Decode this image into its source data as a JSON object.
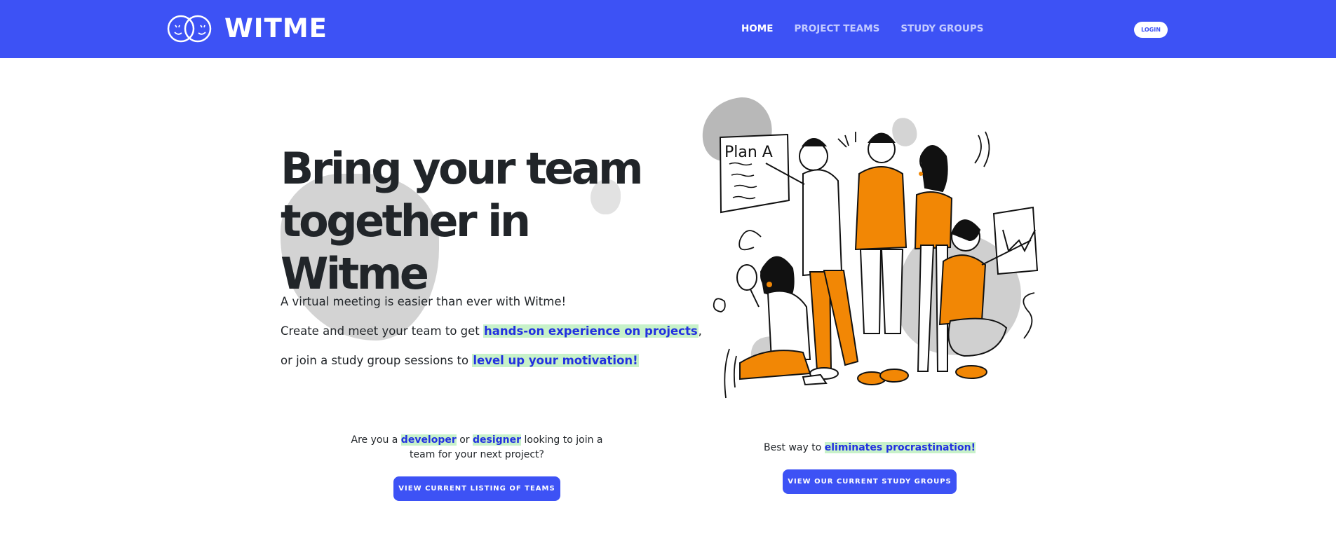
{
  "brand": {
    "name": "WITME",
    "logo_icon": "two-overlapping-smiley-circles-icon"
  },
  "nav": {
    "links": [
      {
        "label": "HOME",
        "active": true
      },
      {
        "label": "PROJECT TEAMS",
        "active": false
      },
      {
        "label": "STUDY GROUPS",
        "active": false
      }
    ],
    "login_label": "LOGIN"
  },
  "hero": {
    "title_line_1": "Bring your team",
    "title_line_2": "together in Witme",
    "line_1": "A virtual meeting is easier than ever with Witme!",
    "line_2_prefix": "Create and meet your team to get ",
    "line_2_highlight": "hands-on experience on projects",
    "line_2_suffix": ",",
    "line_3_prefix": "or join a study group sessions to ",
    "line_3_highlight": "level up your motivation!",
    "illustration_icon": "team-collaboration-illustration",
    "illustration_board_text": "Plan A"
  },
  "cta_teams": {
    "text_prefix": "Are you a ",
    "highlight_1": "developer",
    "text_middle": " or ",
    "highlight_2": "designer",
    "text_suffix": " looking to join a team for your next project?",
    "button_label": "VIEW CURRENT LISTING OF TEAMS"
  },
  "cta_groups": {
    "text_prefix": "Best way to ",
    "highlight": "eliminates procrastination!",
    "button_label": "VIEW OUR CURRENT STUDY GROUPS"
  },
  "colors": {
    "brand_blue": "#3d52f5",
    "highlight_bg": "#c7f1c9",
    "highlight_text": "#2230e0",
    "illustration_orange": "#f28705",
    "blob_gray": "#d3d3d3"
  }
}
